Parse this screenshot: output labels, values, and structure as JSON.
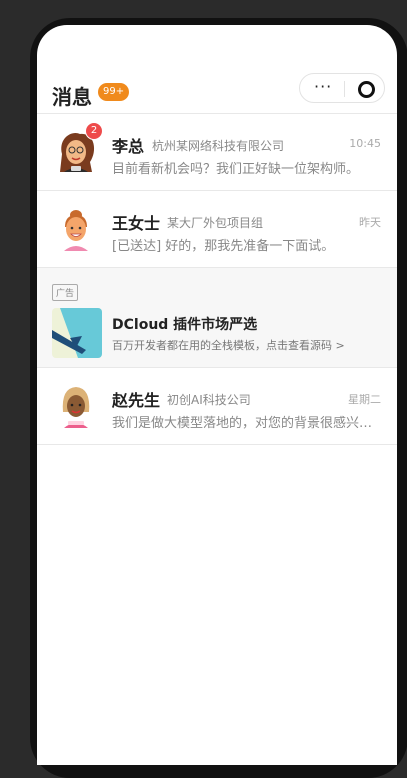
{
  "header": {
    "title": "消息",
    "badge": "99+",
    "capsule_more": "···"
  },
  "conversations": [
    {
      "name": "李总",
      "company": "杭州某网络科技有限公司",
      "time": "10:45",
      "message": "目前看新机会吗？我们正好缺一位架构师。",
      "unread": "2",
      "avatar_icon": "woman-curly-hair-avatar-icon"
    },
    {
      "name": "王女士",
      "company": "某大厂外包项目组",
      "time": "昨天",
      "message": "[已送达] 好的，那我先准备一下面试。",
      "avatar_icon": "woman-ponytail-avatar-icon"
    },
    {
      "name": "赵先生",
      "company": "初创AI科技公司",
      "time": "星期二",
      "message": "我们是做大模型落地的，对您的背景很感兴趣...",
      "avatar_icon": "woman-blonde-avatar-icon"
    }
  ],
  "ad": {
    "tag": "广告",
    "title": "DCloud 插件市场严选",
    "description": "百万开发者都在用的全栈模板，点击查看源码 >"
  },
  "colors": {
    "badge": "#f08a1c",
    "unread": "#ee4b4b",
    "background": "#ffffff",
    "ad_background": "#f7f7f7"
  }
}
